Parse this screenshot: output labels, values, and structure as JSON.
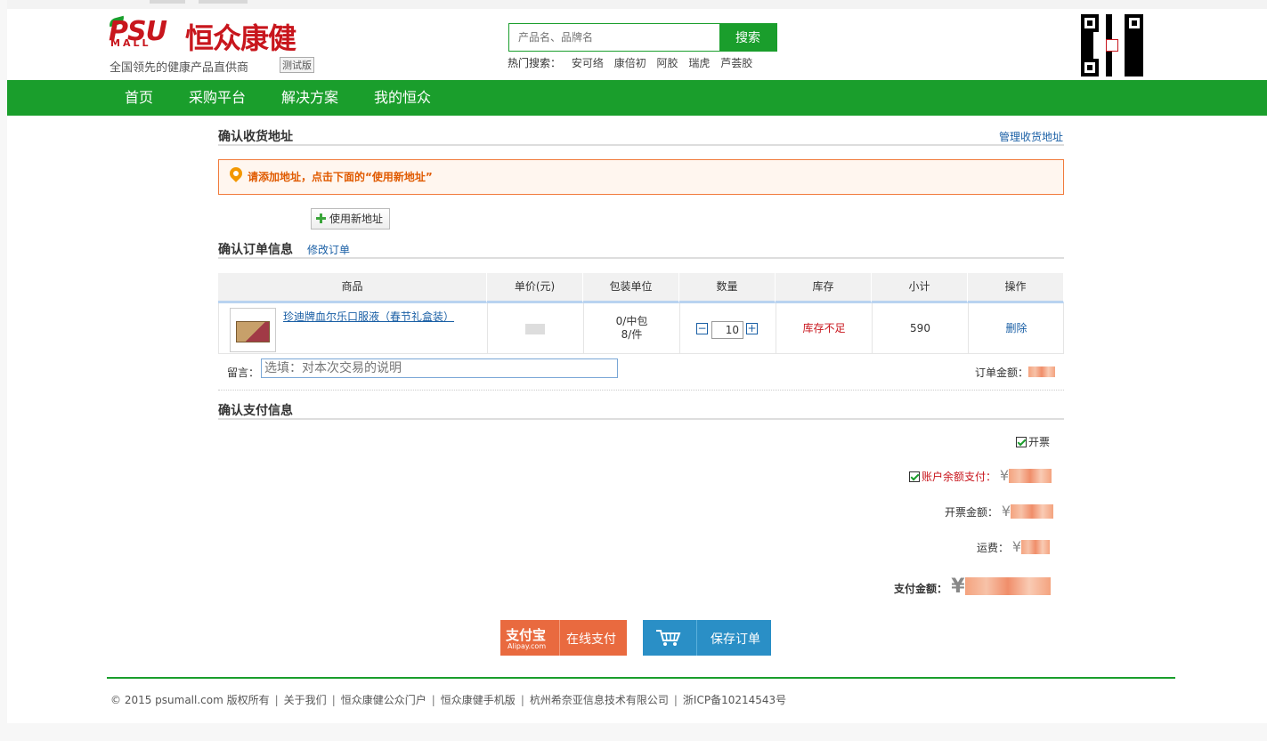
{
  "header": {
    "logo_psu": "PSU",
    "logo_mall": "MALL",
    "logo_brand": "恒众康健",
    "slogan": "全国领先的健康产品直供商",
    "beta": "测试版",
    "search": {
      "placeholder": "产品名、品牌名",
      "button": "搜索"
    },
    "hot_label": "热门搜索：",
    "hot_items": [
      "安可络",
      "康倍初",
      "阿胶",
      "瑞虎",
      "芦荟胶"
    ]
  },
  "nav": {
    "items": [
      "首页",
      "采购平台",
      "解决方案",
      "我的恒众"
    ]
  },
  "address": {
    "title": "确认收货地址",
    "manage_link": "管理收货地址",
    "warning": "请添加地址，点击下面的“使用新地址”",
    "new_button": "使用新地址"
  },
  "order": {
    "title": "确认订单信息",
    "edit_link": "修改订单",
    "columns": [
      "商品",
      "单价(元)",
      "包装单位",
      "数量",
      "库存",
      "小计",
      "操作"
    ],
    "row": {
      "name": "珍迪牌血尔乐口服液（春节礼盒装）",
      "pack_line1": "0/中包",
      "pack_line2": "8/件",
      "qty": "10",
      "qty_minus": "−",
      "qty_plus": "+",
      "stock": "库存不足",
      "subtotal": "590",
      "action": "删除"
    },
    "message_label": "留言：",
    "message_placeholder": "选填：对本次交易的说明",
    "order_amount_label": "订单金额："
  },
  "payment": {
    "title": "确认支付信息",
    "invoice_label": "开票",
    "balance_label": "账户余额支付：",
    "invoice_amount_label": "开票金额：",
    "shipping_label": "运费：",
    "pay_amount_label": "支付金额：",
    "currency": "¥"
  },
  "buttons": {
    "alipay_logo": "支付宝",
    "alipay_sub": "Alipay.com",
    "alipay_label": "在线支付",
    "save_label": "保存订单"
  },
  "footer": {
    "items": [
      "© 2015 psumall.com 版权所有",
      "关于我们",
      "恒众康健公众门户",
      "恒众康健手机版",
      "杭州希奈亚信息技术有限公司",
      "浙ICP备10214543号"
    ]
  },
  "colors": {
    "brand_green": "#1a9e2c",
    "brand_red": "#c8161d",
    "link_blue": "#1a5fa5",
    "alipay_orange": "#e96a3f",
    "save_blue": "#2a8fc6"
  }
}
